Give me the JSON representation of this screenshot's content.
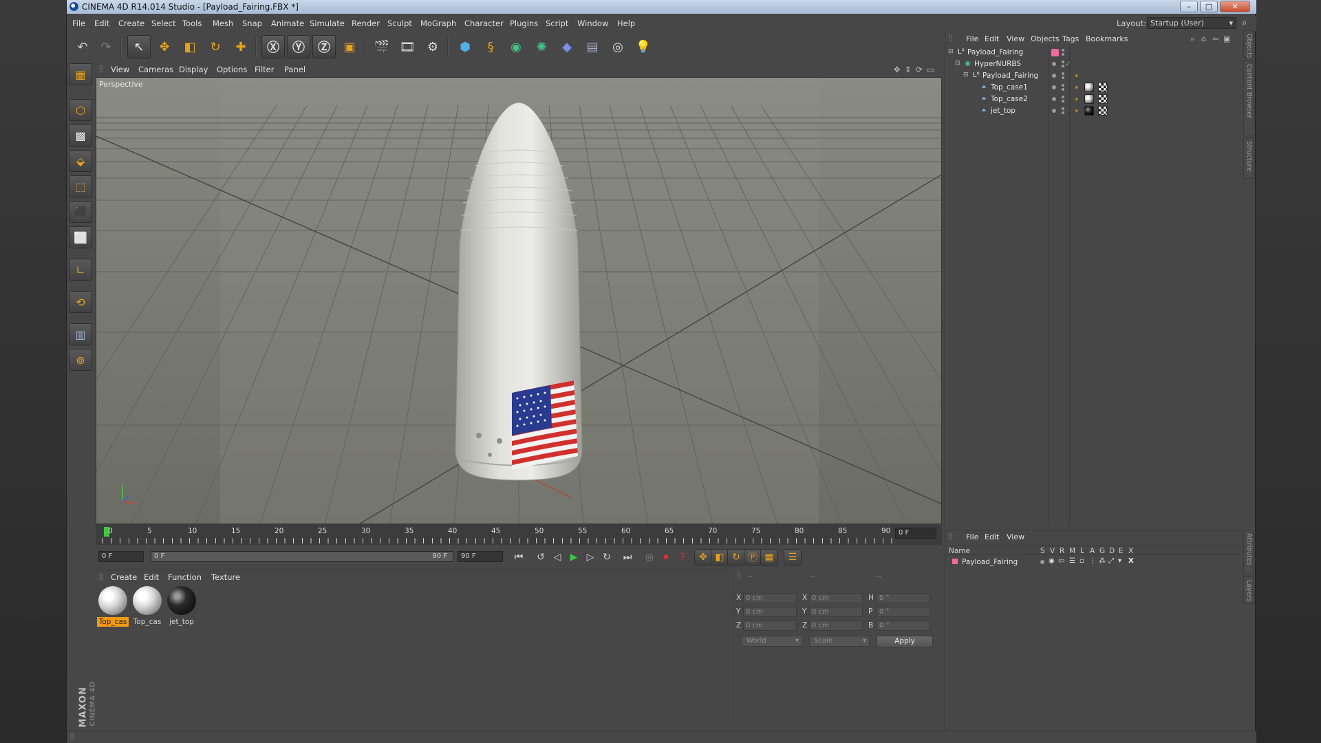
{
  "window": {
    "title": "CINEMA 4D R14.014 Studio - [Payload_Fairing.FBX *]",
    "minimize_glyph": "–",
    "maximize_glyph": "□",
    "close_glyph": "✕"
  },
  "menubar": {
    "items": [
      "File",
      "Edit",
      "Create",
      "Select",
      "Tools",
      "Mesh",
      "Snap",
      "Animate",
      "Simulate",
      "Render",
      "Sculpt",
      "MoGraph",
      "Character",
      "Plugins",
      "Script",
      "Window",
      "Help"
    ],
    "layout_label": "Layout:",
    "layout_value": "Startup (User)"
  },
  "viewport": {
    "menu": [
      "View",
      "Cameras",
      "Display",
      "Options",
      "Filter",
      "Panel"
    ],
    "label": "Perspective"
  },
  "timeline": {
    "ticks": [
      "0",
      "5",
      "10",
      "15",
      "20",
      "25",
      "30",
      "35",
      "40",
      "45",
      "50",
      "55",
      "60",
      "65",
      "70",
      "75",
      "80",
      "85",
      "90"
    ],
    "current_frame": "0 F"
  },
  "transport": {
    "start_field": "0 F",
    "range_start": "0 F",
    "range_end": "90 F",
    "end_field": "90 F"
  },
  "materials": {
    "menu": [
      "Create",
      "Edit",
      "Function",
      "Texture"
    ],
    "items": [
      {
        "label": "Top_cas",
        "selected": true
      },
      {
        "label": "Top_cas",
        "selected": false
      },
      {
        "label": "jet_top",
        "selected": false
      }
    ]
  },
  "coordinates": {
    "header": [
      "--",
      "--",
      "--"
    ],
    "rows": [
      {
        "a": "X",
        "av": "0 cm",
        "b": "X",
        "bv": "0 cm",
        "c": "H",
        "cv": "0 °"
      },
      {
        "a": "Y",
        "av": "0 cm",
        "b": "Y",
        "bv": "0 cm",
        "c": "P",
        "cv": "0 °"
      },
      {
        "a": "Z",
        "av": "0 cm",
        "b": "Z",
        "bv": "0 cm",
        "c": "B",
        "cv": "0 °"
      }
    ],
    "world": "World",
    "scale": "Scale",
    "apply": "Apply"
  },
  "objects": {
    "menu": [
      "File",
      "Edit",
      "View",
      "Objects",
      "Tags",
      "Bookmarks"
    ],
    "rows": [
      {
        "name": "Payload_Fairing",
        "indent": 0
      },
      {
        "name": "HyperNURBS",
        "indent": 1
      },
      {
        "name": "Payload_Fairing",
        "indent": 2
      },
      {
        "name": "Top_case1",
        "indent": 3
      },
      {
        "name": "Top_case2",
        "indent": 3
      },
      {
        "name": "jet_top",
        "indent": 3
      }
    ]
  },
  "layers": {
    "menu": [
      "File",
      "Edit",
      "View"
    ],
    "columns": [
      "Name",
      "S",
      "V",
      "R",
      "M",
      "L",
      "A",
      "G",
      "D",
      "E",
      "X"
    ],
    "row_name": "Payload_Fairing"
  },
  "side_tabs": [
    "Objects",
    "Content Browser",
    "Structure",
    "Attributes",
    "Layers"
  ],
  "logo": {
    "maxon": "MAXON",
    "product": "CINEMA 4D"
  },
  "colors": {
    "accent": "#e8a21a",
    "selected_material": "#f39a15",
    "layer_pink": "#f06b9b"
  }
}
